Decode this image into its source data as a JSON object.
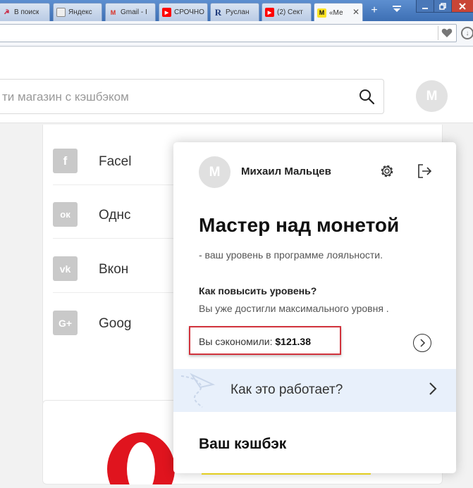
{
  "browser": {
    "tabs": [
      {
        "title": "В поиск",
        "favicon": "ussr-emblem-icon",
        "color": "#c8102e"
      },
      {
        "title": "Яндекс",
        "favicon": "page-icon",
        "color": "#777777"
      },
      {
        "title": "Gmail - I",
        "favicon": "gmail-icon",
        "color": "#d93025"
      },
      {
        "title": "СРОЧНО",
        "favicon": "youtube-icon",
        "color": "#ff0000"
      },
      {
        "title": "Руслан",
        "favicon": "r-logo-icon",
        "color": "#1f3a7a"
      },
      {
        "title": "(2) Сект",
        "favicon": "youtube-icon",
        "color": "#ff0000"
      },
      {
        "title": "«Ме",
        "favicon": "megabonus-icon",
        "color": "#fbe324"
      }
    ],
    "new_tab_symbol": "+"
  },
  "search": {
    "placeholder": "ти магазин с кэшбэком"
  },
  "user": {
    "initial": "М",
    "name": "Михаил Мальцев"
  },
  "social": [
    {
      "name": "Facel",
      "icon": "facebook-icon",
      "glyph": "f"
    },
    {
      "name": "Однс",
      "icon": "odnoklassniki-icon",
      "glyph": "ок"
    },
    {
      "name": "Вкон",
      "icon": "vk-icon",
      "glyph": "vk"
    },
    {
      "name": "Goog",
      "icon": "google-plus-icon",
      "glyph": "G+"
    }
  ],
  "popup": {
    "level_title": "Мастер над монетой",
    "level_subtitle": "- ваш уровень в программе лояльности.",
    "how_up": "Как повысить уровень?",
    "max_level": "Вы уже достигли максимального уровня .",
    "saved_label": "Вы сэкономили: ",
    "saved_value": "$121.38",
    "how_works": "Как это работает?",
    "cashback": "Ваш кэшбэк"
  },
  "colors": {
    "highlight": "#d1323c",
    "popup_band": "#e8f0fb",
    "accent_yellow": "#fbe324"
  }
}
